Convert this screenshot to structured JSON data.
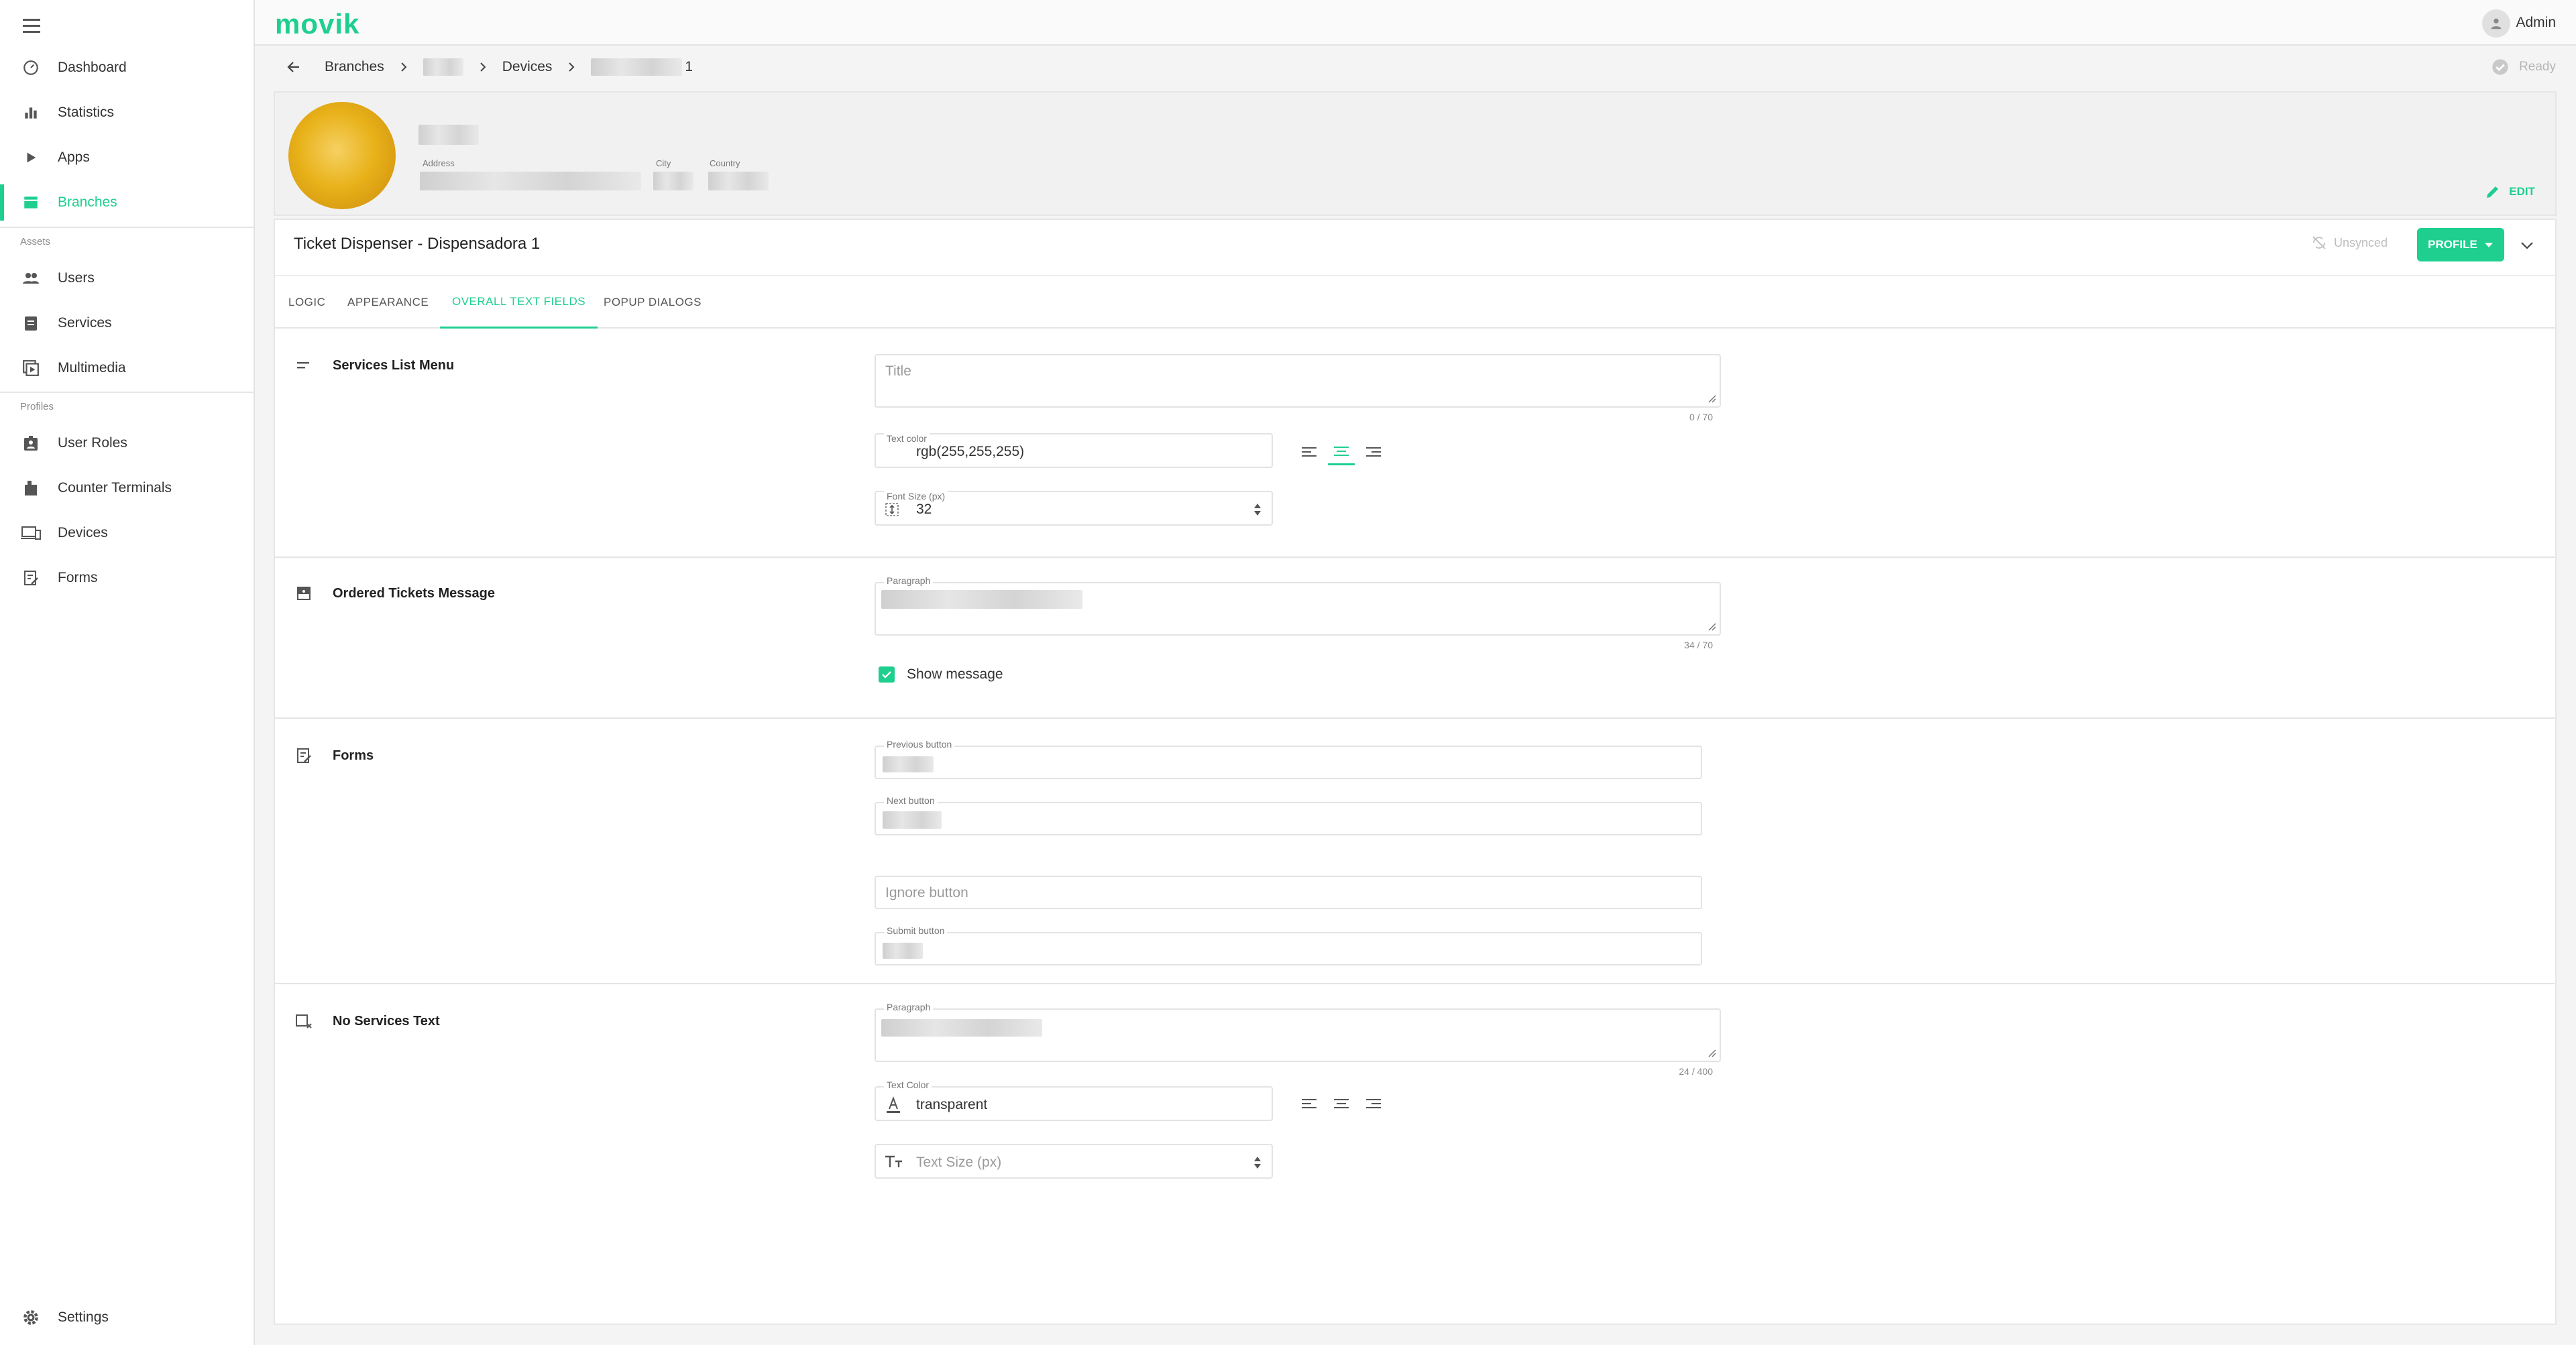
{
  "app": {
    "logo_text": "movik",
    "user_name": "Admin",
    "accent_color": "#1ecf8f"
  },
  "sidebar": {
    "items": [
      {
        "label": "Dashboard",
        "icon": "dashboard-icon"
      },
      {
        "label": "Statistics",
        "icon": "statistics-icon"
      },
      {
        "label": "Apps",
        "icon": "play-icon"
      },
      {
        "label": "Branches",
        "icon": "store-icon",
        "active": true
      }
    ],
    "assets_title": "Assets",
    "assets_items": [
      {
        "label": "Users",
        "icon": "users-icon"
      },
      {
        "label": "Services",
        "icon": "clipboard-icon"
      },
      {
        "label": "Multimedia",
        "icon": "multimedia-icon"
      }
    ],
    "profiles_title": "Profiles",
    "profiles_items": [
      {
        "label": "User Roles",
        "icon": "badge-icon"
      },
      {
        "label": "Counter Terminals",
        "icon": "terminal-icon"
      },
      {
        "label": "Devices",
        "icon": "devices-icon"
      },
      {
        "label": "Forms",
        "icon": "forms-icon"
      }
    ],
    "settings_label": "Settings"
  },
  "breadcrumb": {
    "branches": "Branches",
    "devices": "Devices",
    "device_suffix": "1"
  },
  "status": {
    "ready": "Ready"
  },
  "branch": {
    "address_label": "Address",
    "city_label": "City",
    "country_label": "Country",
    "edit_label": "EDIT"
  },
  "device": {
    "title": "Ticket Dispenser -  Dispensadora 1",
    "unsynced": "Unsynced",
    "profile_button": "PROFILE"
  },
  "tabs": [
    "LOGIC",
    "APPEARANCE",
    "OVERALL TEXT FIELDS",
    "POPUP DIALOGS"
  ],
  "active_tab": "OVERALL TEXT FIELDS",
  "sections": {
    "services_list": {
      "title": "Services List Menu",
      "title_placeholder": "Title",
      "title_counter": "0 / 70",
      "text_color_label": "Text color",
      "text_color_value": "rgb(255,255,255)",
      "font_size_label": "Font Size (px)",
      "font_size_value": "32",
      "alignment": "center"
    },
    "ordered_tickets": {
      "title": "Ordered Tickets Message",
      "paragraph_label": "Paragraph",
      "counter": "34 / 70",
      "show_message_label": "Show message",
      "show_message_checked": true
    },
    "forms": {
      "title": "Forms",
      "previous_label": "Previous button",
      "next_label": "Next button",
      "ignore_placeholder": "Ignore button",
      "submit_label": "Submit button"
    },
    "no_services": {
      "title": "No Services Text",
      "paragraph_label": "Paragraph",
      "counter": "24 / 400",
      "text_color_label": "Text Color",
      "text_color_value": "transparent",
      "text_size_placeholder": "Text Size (px)",
      "alignment": "none"
    }
  }
}
